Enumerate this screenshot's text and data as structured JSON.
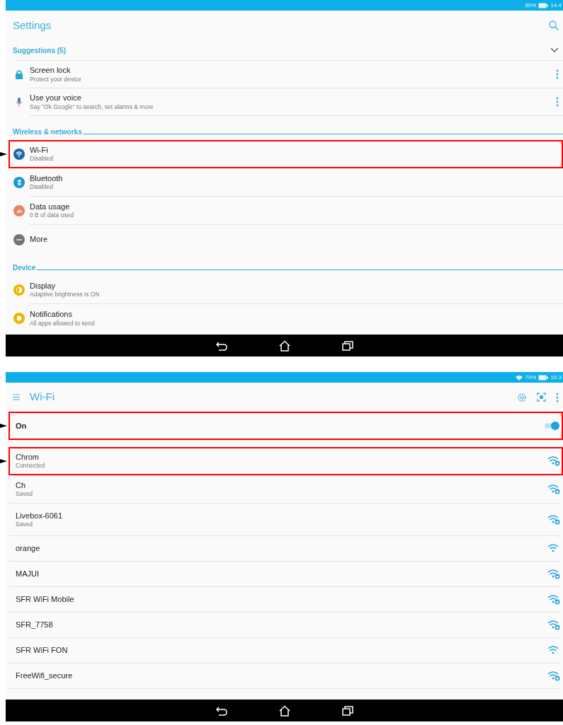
{
  "settings": {
    "status_bar": {
      "battery": "80%",
      "time": "14:4"
    },
    "title": "Settings",
    "suggestions": {
      "title": "Suggestions (5)",
      "items": [
        {
          "title": "Screen lock",
          "subtitle": "Protect your device"
        },
        {
          "title": "Use your voice",
          "subtitle": "Say \"Ok Google\" to search, set alarms & more"
        }
      ]
    },
    "sections": [
      {
        "title": "Wireless & networks",
        "items": [
          {
            "title": "Wi-Fi",
            "subtitle": "Disabled",
            "color": "#1f6aa0",
            "highlighted": true
          },
          {
            "title": "Bluetooth",
            "subtitle": "Disabled",
            "color": "#1a98d5",
            "highlighted": false
          },
          {
            "title": "Data usage",
            "subtitle": "0 B of data used",
            "color": "#e8845c",
            "highlighted": false
          },
          {
            "title": "More",
            "color": "#6e7875",
            "highlighted": false
          }
        ]
      },
      {
        "title": "Device",
        "items": [
          {
            "title": "Display",
            "subtitle": "Adaptive brightness is ON",
            "color": "#f0b400",
            "highlighted": false
          },
          {
            "title": "Notifications",
            "subtitle": "All apps allowed to send",
            "color": "#f0b400",
            "highlighted": false
          }
        ]
      }
    ]
  },
  "wifi": {
    "status_bar": {
      "battery": "79%",
      "time": "15:3"
    },
    "title": "Wi-Fi",
    "toggle": {
      "label": "On",
      "on": true,
      "highlighted": true
    },
    "networks": [
      {
        "name": "Chrom",
        "status": "Connected",
        "secured": true,
        "highlighted": true
      },
      {
        "name": "Ch",
        "status": "Saved",
        "secured": true,
        "highlighted": false
      },
      {
        "name": "Livebox-6061",
        "status": "Saved",
        "secured": true,
        "highlighted": false
      },
      {
        "name": "orange",
        "secured": false,
        "highlighted": false
      },
      {
        "name": "MAJUI",
        "secured": true,
        "highlighted": false
      },
      {
        "name": "SFR WiFi Mobile",
        "secured": true,
        "highlighted": false
      },
      {
        "name": "SFR_7758",
        "secured": true,
        "highlighted": false
      },
      {
        "name": "SFR WiFi FON",
        "secured": false,
        "highlighted": false
      },
      {
        "name": "FreeWifi_secure",
        "secured": true,
        "highlighted": false
      }
    ]
  }
}
